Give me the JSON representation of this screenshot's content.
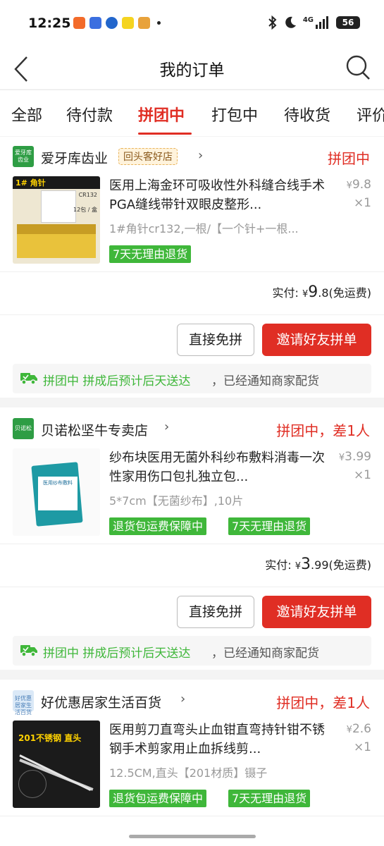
{
  "status_bar": {
    "time": "12:25",
    "network": "4G",
    "battery": "56"
  },
  "nav": {
    "title": "我的订单"
  },
  "tabs": [
    {
      "label": "全部"
    },
    {
      "label": "待付款"
    },
    {
      "label": "拼团中"
    },
    {
      "label": "打包中"
    },
    {
      "label": "待收货"
    },
    {
      "label": "评价"
    }
  ],
  "active_tab": "拼团中",
  "orders": [
    {
      "shop_logo": "爱牙库齿业",
      "shop": "爱牙库齿业",
      "badge": "回头客好店",
      "status": "拼团中",
      "title": "医用上海金环可吸收性外科缝合线手术PGA缝线带针双眼皮整形...",
      "price_symbol": "¥",
      "price": "9.8",
      "qty": "×1",
      "sku": "1#角针cr132,一根/【一个针+一根...",
      "tags": [
        "7天无理由退货"
      ],
      "paid_label": "实付:",
      "paid_symbol": "¥",
      "paid_int": "9",
      "paid_dec": ".8",
      "paid_note": "(免运费)",
      "btn_direct": "直接免拼",
      "btn_invite": "邀请好友拼单",
      "notice_green": "拼团中 拼成后预计后天送达",
      "notice_grey": "，已经通知商家配货",
      "thumb_label": "1# 角针",
      "thumb_code": "CR132",
      "thumb_pack": "12包 / 盒"
    },
    {
      "shop_logo": "贝诺松",
      "shop": "贝诺松坚牛专卖店",
      "status": "拼团中，差1人",
      "title": "纱布块医用无菌外科纱布敷料消毒一次性家用伤口包扎独立包...",
      "price_symbol": "¥",
      "price": "3.99",
      "qty": "×1",
      "sku": "5*7cm【无菌纱布】,10片",
      "tags": [
        "退货包运费保障中",
        "7天无理由退货"
      ],
      "paid_label": "实付:",
      "paid_symbol": "¥",
      "paid_int": "3",
      "paid_dec": ".99",
      "paid_note": "(免运费)",
      "btn_direct": "直接免拼",
      "btn_invite": "邀请好友拼单",
      "notice_green": "拼团中 拼成后预计后天送达",
      "notice_grey": "，已经通知商家配货",
      "thumb_label": "医用纱布敷料"
    },
    {
      "shop_logo": "好优惠居家生活百货",
      "shop": "好优惠居家生活百货",
      "status": "拼团中，差1人",
      "title": "医用剪刀直弯头止血钳直弯持针钳不锈钢手术剪家用止血拆线剪...",
      "price_symbol": "¥",
      "price": "2.6",
      "qty": "×1",
      "sku": "12.5CM,直头【201材质】镊子",
      "tags": [
        "退货包运费保障中",
        "7天无理由退货"
      ],
      "thumb_label": "201不锈钢 直头"
    }
  ],
  "colors": {
    "accent": "#e02e24",
    "green": "#3fb73a",
    "grey_text": "#999999"
  },
  "icons": {
    "back": "chevron-left-icon",
    "search": "search-icon",
    "truck": "truck-icon",
    "chevron": "chevron-right-icon"
  }
}
